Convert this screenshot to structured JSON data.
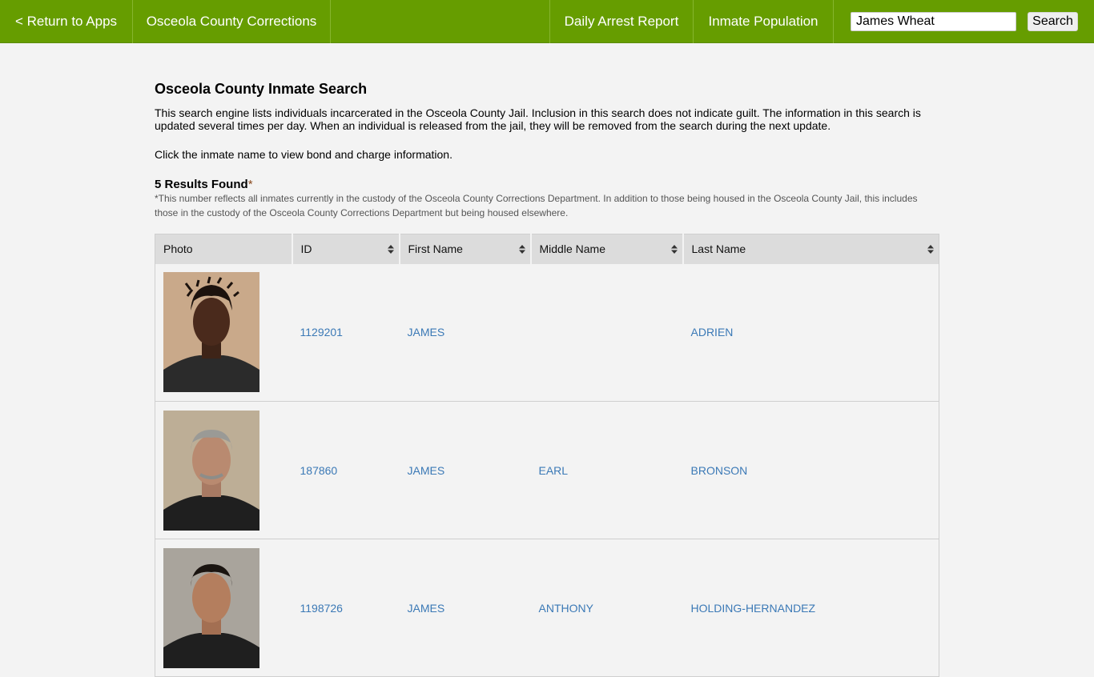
{
  "nav": {
    "return_label": "< Return to Apps",
    "title": "Osceola County Corrections",
    "daily_arrest": "Daily Arrest Report",
    "inmate_population": "Inmate Population",
    "search_value": "James Wheat",
    "search_button": "Search"
  },
  "page": {
    "title": "Osceola County Inmate Search",
    "intro": "This search engine lists individuals incarcerated in the Osceola County Jail. Inclusion in this search does not indicate guilt. The information in this search is updated several times per day. When an individual is released from the jail, they will be removed from the search during the next update.",
    "click_note": "Click the inmate name to view bond and charge information.",
    "results_count": "5 Results Found",
    "results_asterisk": "*",
    "footnote": "*This number reflects all inmates currently in the custody of the Osceola County Corrections Department. In addition to those being housed in the Osceola County Jail, this includes those in the custody of the Osceola County Corrections Department but being housed elsewhere."
  },
  "table": {
    "columns": [
      "Photo",
      "ID",
      "First Name",
      "Middle Name",
      "Last Name"
    ],
    "rows": [
      {
        "id": "1129201",
        "first": "JAMES",
        "middle": "",
        "last": "ADRIEN"
      },
      {
        "id": "187860",
        "first": "JAMES",
        "middle": "EARL",
        "last": "BRONSON"
      },
      {
        "id": "1198726",
        "first": "JAMES",
        "middle": "ANTHONY",
        "last": "HOLDING-HERNANDEZ"
      }
    ]
  },
  "colors": {
    "nav_green": "#669d00",
    "link_blue": "#3b79b6"
  }
}
